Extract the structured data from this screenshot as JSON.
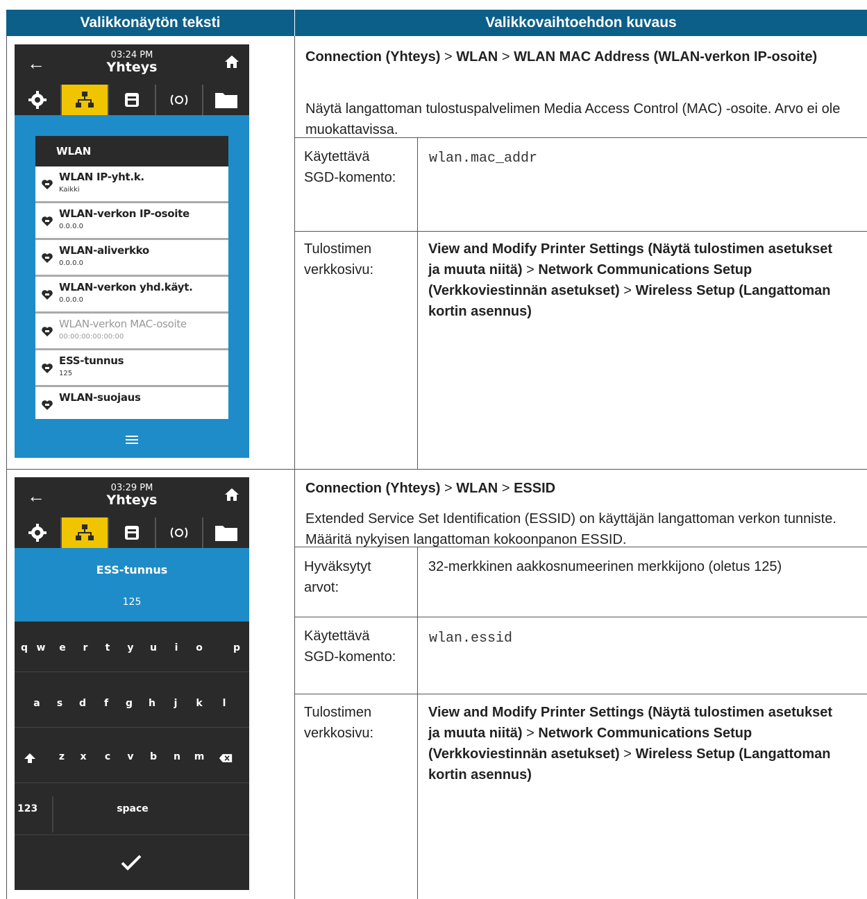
{
  "table": {
    "header_left": "Valikkonäytön teksti",
    "header_right": "Valikkovaihtoehdon kuvaus"
  },
  "row1": {
    "screen": {
      "time": "03:24 PM",
      "title": "Yhteys",
      "section": "WLAN",
      "items": [
        {
          "label": "WLAN IP-yht.k.",
          "value": "Kaikki"
        },
        {
          "label": "WLAN-verkon IP-osoite",
          "value": "0.0.0.0"
        },
        {
          "label": "WLAN-aliverkko",
          "value": "0.0.0.0"
        },
        {
          "label": "WLAN-verkon yhd.käyt.",
          "value": "0.0.0.0"
        },
        {
          "label": "WLAN-verkon MAC-osoite",
          "value": "00:00:00:00:00:00"
        },
        {
          "label": "ESS-tunnus",
          "value": "125"
        },
        {
          "label": "WLAN-suojaus",
          "value": ""
        }
      ]
    },
    "path_a": "Connection (Yhteys)",
    "sep": ">",
    "path_b": "WLAN",
    "path_c": "WLAN MAC Address (WLAN-verkon IP-osoite)",
    "description": "Näytä langattoman tulostuspalvelimen Media Access Control (MAC) -osoite. Arvo ei ole muokattavissa.",
    "sgd_label": "Käytettävä SGD-komento:",
    "sgd_value": "wlan.mac_addr",
    "web_label": "Tulostimen verkkosivu:",
    "web_a": "View and Modify Printer Settings (Näytä tulostimen asetukset ja muuta niitä)",
    "web_b": "Network Communications Setup (Verkkoviestinnän asetukset)",
    "web_c": "Wireless Setup (Langattoman kortin asennus)"
  },
  "row2": {
    "screen": {
      "time": "03:29 PM",
      "title": "Yhteys",
      "field_title": "ESS-tunnus",
      "field_value": "125",
      "keys_row1": [
        "q",
        "w",
        "e",
        "r",
        "t",
        "y",
        "u",
        "i",
        "o",
        "p"
      ],
      "keys_row2": [
        "a",
        "s",
        "d",
        "f",
        "g",
        "h",
        "j",
        "k",
        "l"
      ],
      "keys_row3": [
        "z",
        "x",
        "c",
        "v",
        "b",
        "n",
        "m"
      ],
      "key_123": "123",
      "key_space": "space"
    },
    "path_a": "Connection (Yhteys)",
    "sep": ">",
    "path_b": "WLAN",
    "path_c": "ESSID",
    "description": "Extended Service Set Identification (ESSID) on käyttäjän langattoman verkon tunniste. Määritä nykyisen langattoman kokoonpanon ESSID.",
    "accepted_label": "Hyväksytyt arvot:",
    "accepted_value": "32-merkkinen aakkosnumeerinen merkkijono (oletus 125)",
    "sgd_label": "Käytettävä SGD-komento:",
    "sgd_value": "wlan.essid",
    "web_label": "Tulostimen verkkosivu:",
    "web_a": "View and Modify Printer Settings (Näytä tulostimen asetukset ja muuta niitä)",
    "web_b": "Network Communications Setup (Verkkoviestinnän asetukset)",
    "web_c": "Wireless Setup (Langattoman kortin asennus)"
  },
  "colors": {
    "header": "#0c5f88",
    "screen_blue": "#1e8cc8",
    "tab_active": "#f0c500",
    "screen_dark": "#2a2a2a"
  }
}
